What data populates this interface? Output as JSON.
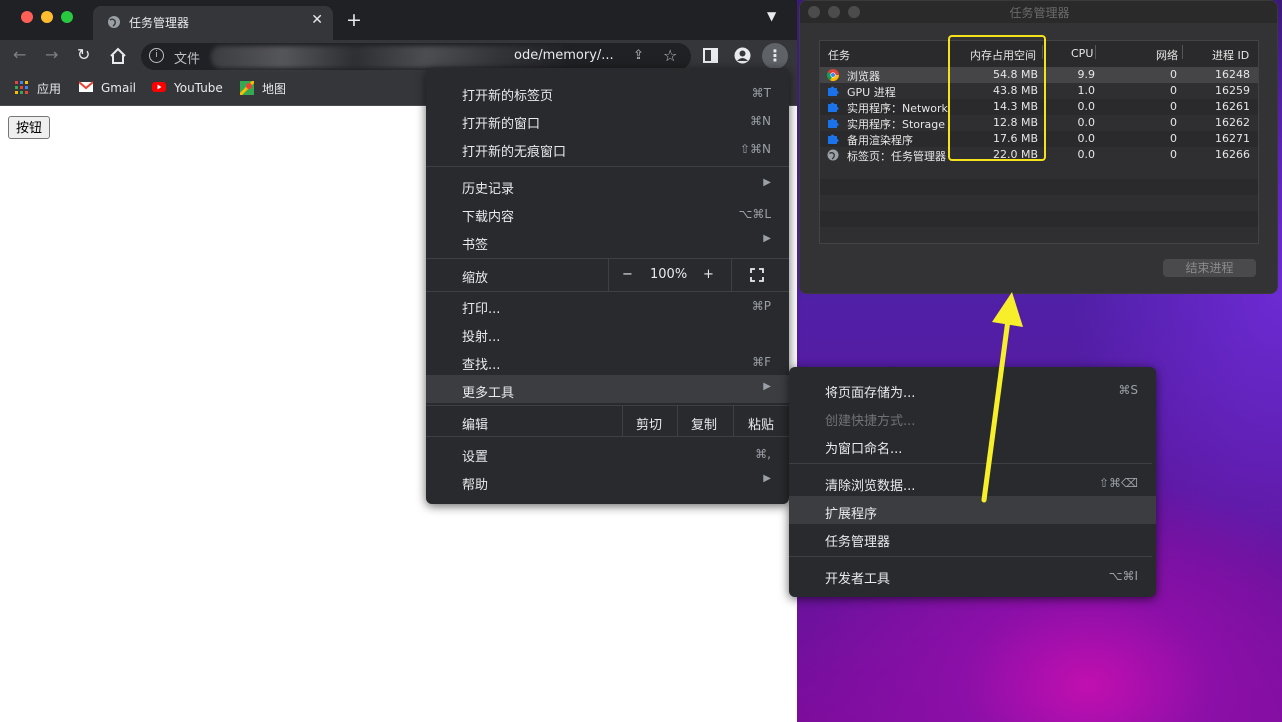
{
  "browser": {
    "tab_title": "任务管理器",
    "new_tab_symbol": "+",
    "address": {
      "scheme_label": "文件",
      "url_visible": "ode/memory/..."
    },
    "bookmarks": [
      {
        "label": "应用"
      },
      {
        "label": "Gmail"
      },
      {
        "label": "YouTube"
      },
      {
        "label": "地图"
      }
    ],
    "page_button_label": "按钮"
  },
  "chrome_menu": {
    "new_tab": {
      "label": "打开新的标签页",
      "shortcut": "⌘T"
    },
    "new_window": {
      "label": "打开新的窗口",
      "shortcut": "⌘N"
    },
    "incognito": {
      "label": "打开新的无痕窗口",
      "shortcut": "⇧⌘N"
    },
    "history": {
      "label": "历史记录"
    },
    "downloads": {
      "label": "下载内容",
      "shortcut": "⌥⌘L"
    },
    "bookmarks": {
      "label": "书签"
    },
    "zoom": {
      "label": "缩放",
      "minus": "−",
      "value": "100%",
      "plus": "+"
    },
    "print": {
      "label": "打印...",
      "shortcut": "⌘P"
    },
    "cast": {
      "label": "投射..."
    },
    "find": {
      "label": "查找...",
      "shortcut": "⌘F"
    },
    "more_tools": {
      "label": "更多工具"
    },
    "edit": {
      "label": "编辑",
      "cut": "剪切",
      "copy": "复制",
      "paste": "粘贴"
    },
    "settings": {
      "label": "设置",
      "shortcut": "⌘,"
    },
    "help": {
      "label": "帮助"
    }
  },
  "more_tools_menu": {
    "save_page": {
      "label": "将页面存储为...",
      "shortcut": "⌘S"
    },
    "create_shortcut": {
      "label": "创建快捷方式..."
    },
    "name_window": {
      "label": "为窗口命名..."
    },
    "clear_data": {
      "label": "清除浏览数据...",
      "shortcut": "⇧⌘⌫"
    },
    "extensions": {
      "label": "扩展程序"
    },
    "task_manager": {
      "label": "任务管理器"
    },
    "dev_tools": {
      "label": "开发者工具",
      "shortcut": "⌥⌘I"
    }
  },
  "task_manager": {
    "title": "任务管理器",
    "columns": {
      "task": "任务",
      "memory": "内存占用空间",
      "cpu": "CPU",
      "network": "网络",
      "pid": "进程 ID"
    },
    "rows": [
      {
        "task": "浏览器",
        "memory": "54.8 MB",
        "cpu": "9.9",
        "network": "0",
        "pid": "16248",
        "icon": "chrome-icon"
      },
      {
        "task": "GPU 进程",
        "memory": "43.8 MB",
        "cpu": "1.0",
        "network": "0",
        "pid": "16259",
        "icon": "puzzle-icon"
      },
      {
        "task": "实用程序：Network",
        "memory": "14.3 MB",
        "cpu": "0.0",
        "network": "0",
        "pid": "16261",
        "icon": "puzzle-icon"
      },
      {
        "task": "实用程序：Storage",
        "memory": "12.8 MB",
        "cpu": "0.0",
        "network": "0",
        "pid": "16262",
        "icon": "puzzle-icon"
      },
      {
        "task": "备用渲染程序",
        "memory": "17.6 MB",
        "cpu": "0.0",
        "network": "0",
        "pid": "16271",
        "icon": "puzzle-icon"
      },
      {
        "task": "标签页：任务管理器",
        "memory": "22.0 MB",
        "cpu": "0.0",
        "network": "0",
        "pid": "16266",
        "icon": "globe-icon"
      }
    ],
    "end_process_label": "结束进程"
  },
  "colors": {
    "annotation": "#f4e21c",
    "menu_bg": "#292a2d",
    "toolbar_bg": "#35363a"
  }
}
